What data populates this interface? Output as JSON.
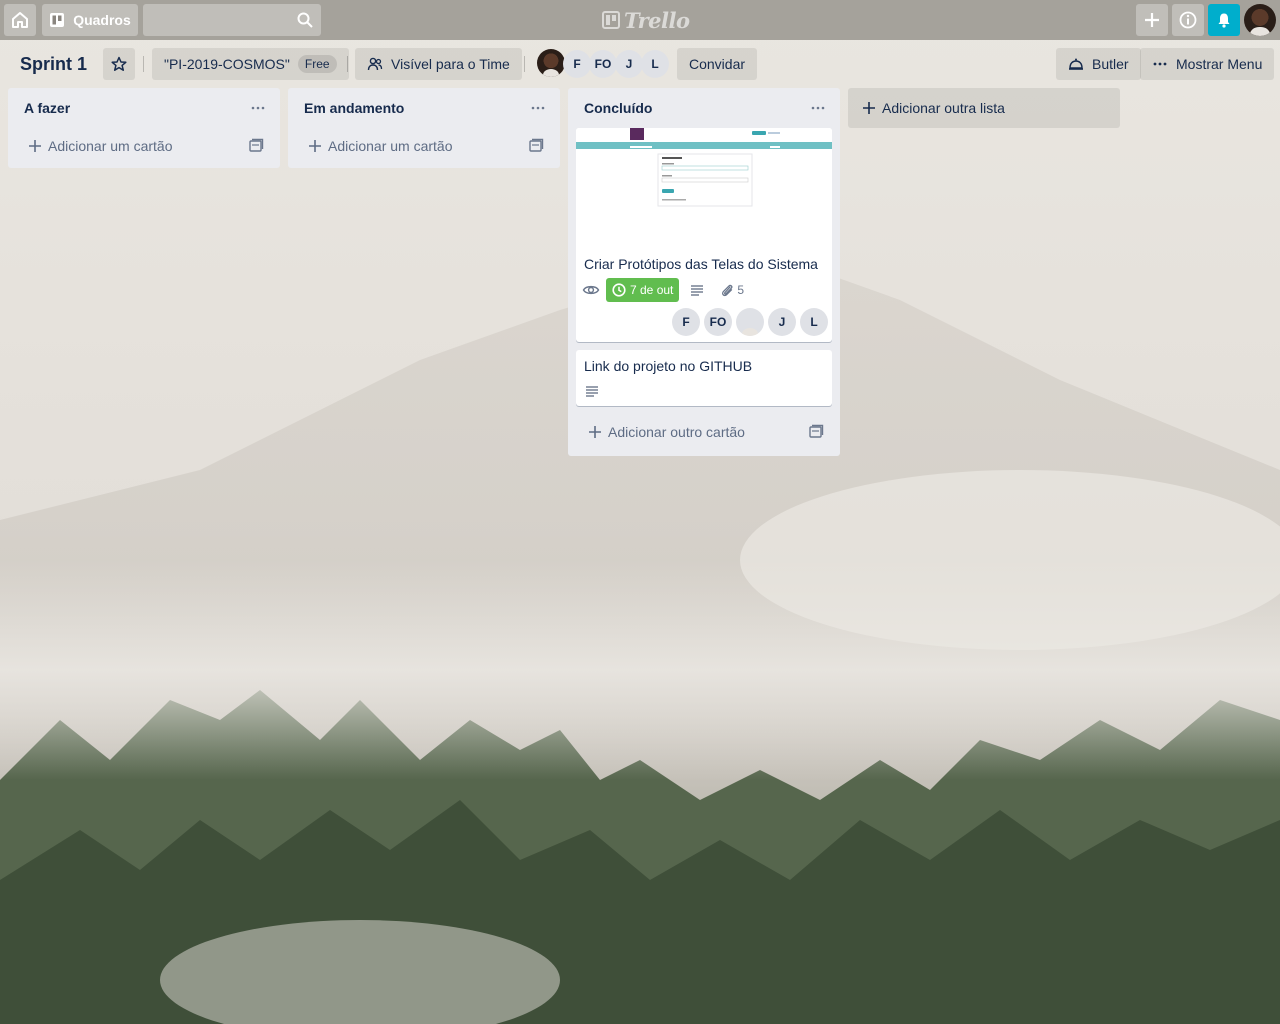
{
  "topbar": {
    "boards_label": "Quadros",
    "search_placeholder": "",
    "logo_text": "Trello",
    "bell_color": "#00aecc"
  },
  "board": {
    "title": "Sprint 1",
    "team_name": "\"PI-2019-COSMOS\"",
    "plan_badge": "Free",
    "visibility_label": "Visível para o Time",
    "members": [
      "F",
      "FO",
      "J",
      "L"
    ],
    "invite_label": "Convidar",
    "butler_label": "Butler",
    "menu_label": "Mostrar Menu",
    "background": "foggy forest"
  },
  "lists": [
    {
      "title": "A fazer",
      "add_card_label": "Adicionar um cartão"
    },
    {
      "title": "Em andamento",
      "add_card_label": "Adicionar um cartão"
    },
    {
      "title": "Concluído",
      "add_card_label": "Adicionar outro cartão",
      "cards": [
        {
          "title": "Criar Protótipos das Telas do Sistema",
          "due_date": "7 de out",
          "due_color": "#61bd4f",
          "attachments": "5",
          "members": [
            "F",
            "FO",
            "J",
            "L"
          ],
          "has_description": true,
          "watching": true
        },
        {
          "title": "Link do projeto no GITHUB",
          "has_description": true
        }
      ]
    }
  ],
  "add_list_label": "Adicionar outra lista"
}
